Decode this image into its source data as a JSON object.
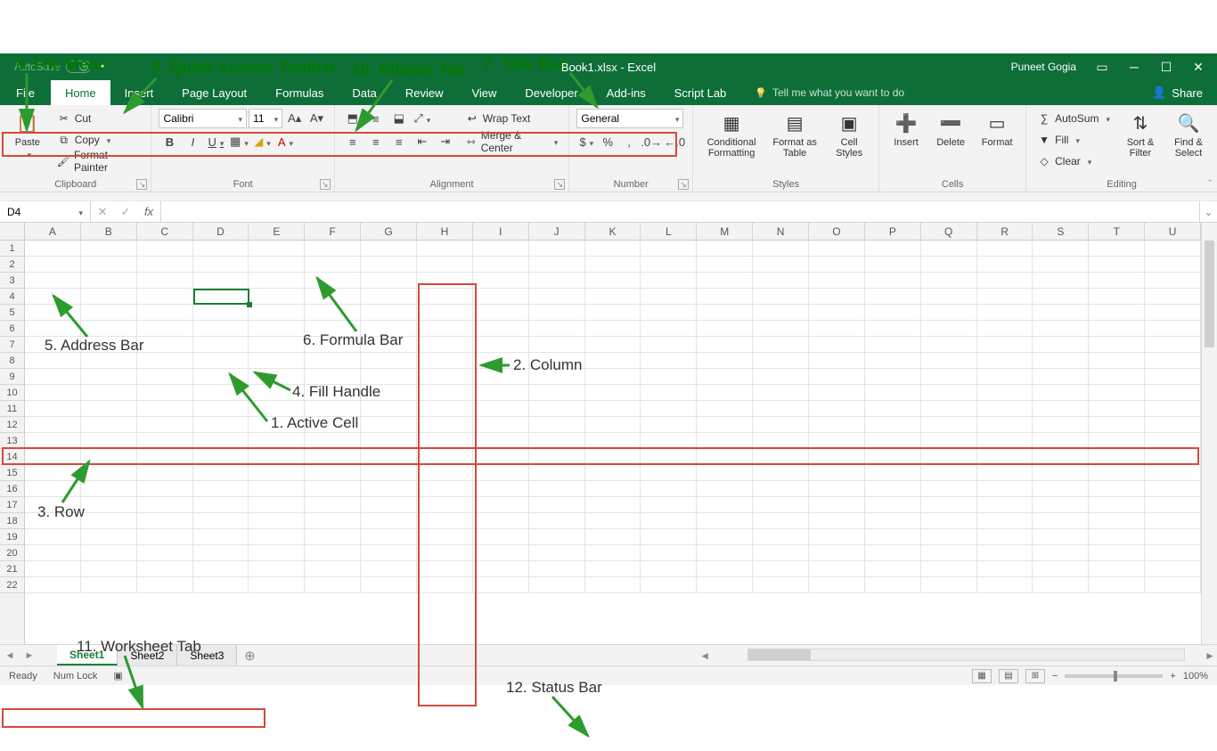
{
  "annotations": {
    "a1": "1. Active Cell",
    "a2": "2. Column",
    "a3": "3. Row",
    "a4": "4. Fill Handle",
    "a5": "5. Address Bar",
    "a6": "6. Formula Bar",
    "a7": "7. Title Bar",
    "a8": "8. File Menu",
    "a9": "9. Quick Access Toolbar",
    "a10": "10. Ribbon Tab",
    "a11": "11. Worksheet Tab",
    "a12": "12. Status Bar"
  },
  "titlebar": {
    "autosave": "AutoSave",
    "autosave_state": "Off",
    "title": "Book1.xlsx  -  Excel",
    "user": "Puneet Gogia"
  },
  "tabs": {
    "file": "File",
    "home": "Home",
    "insert": "Insert",
    "page_layout": "Page Layout",
    "formulas": "Formulas",
    "data": "Data",
    "review": "Review",
    "view": "View",
    "developer": "Developer",
    "addins": "Add-ins",
    "scriptlab": "Script Lab",
    "tellme": "Tell me what you want to do",
    "share": "Share"
  },
  "ribbon": {
    "clipboard": {
      "label": "Clipboard",
      "paste": "Paste",
      "cut": "Cut",
      "copy": "Copy",
      "fmt": "Format Painter"
    },
    "font": {
      "label": "Font",
      "name": "Calibri",
      "size": "11"
    },
    "alignment": {
      "label": "Alignment",
      "wrap": "Wrap Text",
      "merge": "Merge & Center"
    },
    "number": {
      "label": "Number",
      "format": "General"
    },
    "styles": {
      "label": "Styles",
      "cond": "Conditional Formatting",
      "table": "Format as Table",
      "cell": "Cell Styles"
    },
    "cells": {
      "label": "Cells",
      "insert": "Insert",
      "delete": "Delete",
      "format": "Format"
    },
    "editing": {
      "label": "Editing",
      "autosum": "AutoSum",
      "fill": "Fill",
      "clear": "Clear",
      "sort": "Sort & Filter",
      "find": "Find & Select"
    }
  },
  "namebox": "D4",
  "columns": [
    "A",
    "B",
    "C",
    "D",
    "E",
    "F",
    "G",
    "H",
    "I",
    "J",
    "K",
    "L",
    "M",
    "N",
    "O",
    "P",
    "Q",
    "R",
    "S",
    "T",
    "U"
  ],
  "rows": [
    "1",
    "2",
    "3",
    "4",
    "5",
    "6",
    "7",
    "8",
    "9",
    "10",
    "11",
    "12",
    "13",
    "14",
    "15",
    "16",
    "17",
    "18",
    "19",
    "20",
    "21",
    "22"
  ],
  "sheets": {
    "s1": "Sheet1",
    "s2": "Sheet2",
    "s3": "Sheet3"
  },
  "status": {
    "ready": "Ready",
    "numlock": "Num Lock",
    "zoom": "100%"
  }
}
